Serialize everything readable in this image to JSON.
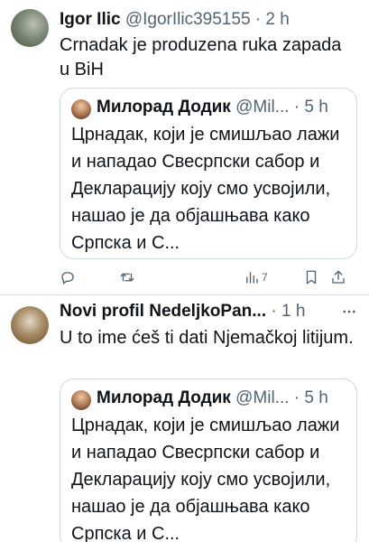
{
  "tweets": [
    {
      "name": "Igor Ilic",
      "handle": "@IgorIlic395155",
      "dot": "·",
      "time": "2 h",
      "text": "Crnadak je produzena ruka zapada u BiH",
      "quote": {
        "name": "Милорад Додик",
        "handle": "@Mil...",
        "dot": "·",
        "time": "5 h",
        "text": "Црнадак, који је смишљао лажи и нападао Свесрпски сабор и Декларацију коју смо усвојили, нашао је да објашњава како Српска и С..."
      },
      "actions": {
        "views": "7"
      }
    },
    {
      "name": "Novi profil NedeljkoPan...",
      "handle": "",
      "dot": "·",
      "time": "1 h",
      "text": "U to ime ćeš ti dati Njemačkoj litijum.",
      "quote": {
        "name": "Милорад Додик",
        "handle": "@Mil...",
        "dot": "·",
        "time": "5 h",
        "text": "Црнадак, који је смишљао лажи и нападао Свесрпски сабор и Декларацију коју смо усвојили, нашао је да објашњава како Српска и С..."
      }
    }
  ],
  "icons": {
    "reply": "reply-icon",
    "retweet": "retweet-icon",
    "views": "views-icon",
    "bookmark": "bookmark-icon",
    "share": "share-icon",
    "more": "more-icon"
  },
  "colors": {
    "text": "#0f1419",
    "secondary": "#536471",
    "border": "#cfd9de"
  }
}
